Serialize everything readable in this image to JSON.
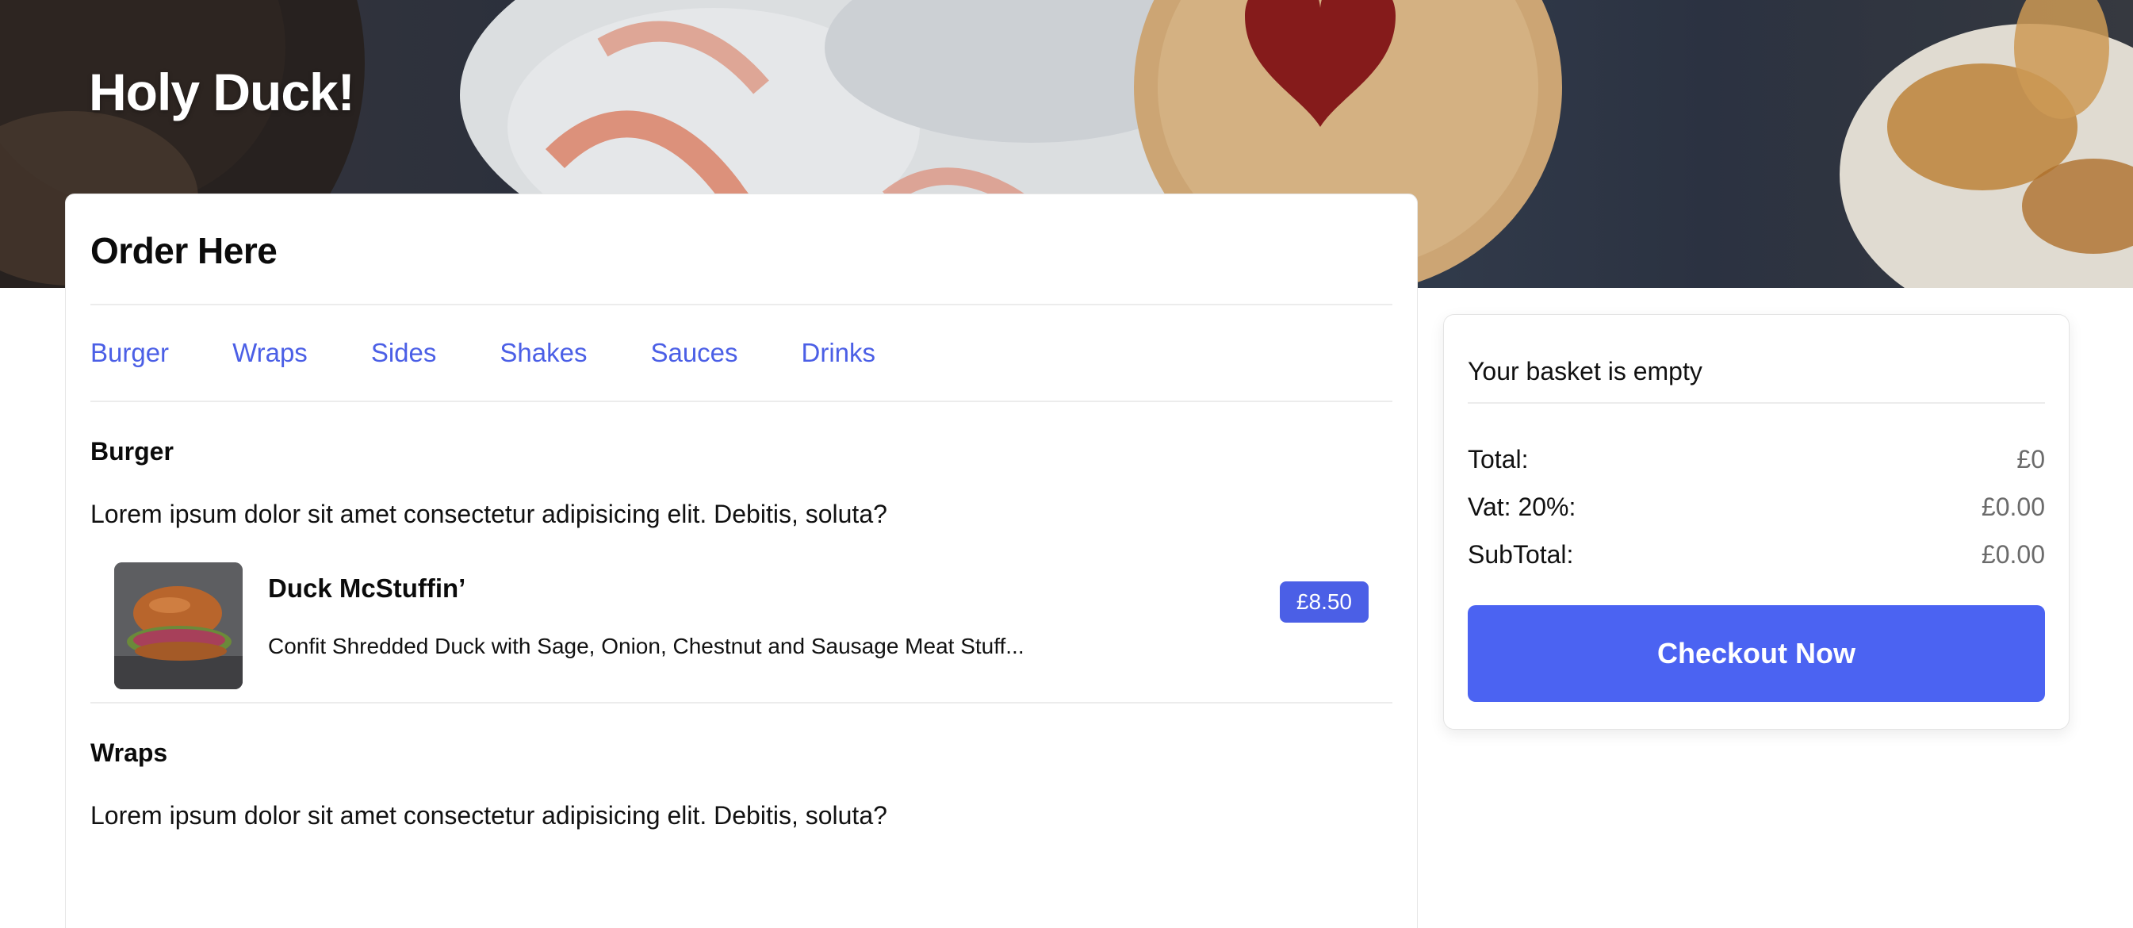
{
  "header": {
    "brand": "Holy Duck!"
  },
  "order": {
    "title": "Order Here",
    "tabs": [
      "Burger",
      "Wraps",
      "Sides",
      "Shakes",
      "Sauces",
      "Drinks"
    ],
    "sections": [
      {
        "heading": "Burger",
        "description": "Lorem ipsum dolor sit amet consectetur adipisicing elit. Debitis, soluta?",
        "products": [
          {
            "name": "Duck McStuffin’",
            "description": "Confit Shredded Duck with Sage, Onion, Chestnut and Sausage Meat Stuff...",
            "price": "£8.50"
          }
        ]
      },
      {
        "heading": "Wraps",
        "description": "Lorem ipsum dolor sit amet consectetur adipisicing elit. Debitis, soluta?"
      }
    ]
  },
  "basket": {
    "status": "Your basket is empty",
    "rows": [
      {
        "label": "Total:",
        "value": "£0"
      },
      {
        "label": "Vat: 20%:",
        "value": "£0.00"
      },
      {
        "label": "SubTotal:",
        "value": "£0.00"
      }
    ],
    "checkout_label": "Checkout Now"
  },
  "colors": {
    "accent": "#4b63f2",
    "link": "#4b5fe6",
    "banner_dark": "#2c3340"
  },
  "icons": {
    "hero_image": "dessert-banner-image",
    "product_image": "burger-image"
  }
}
